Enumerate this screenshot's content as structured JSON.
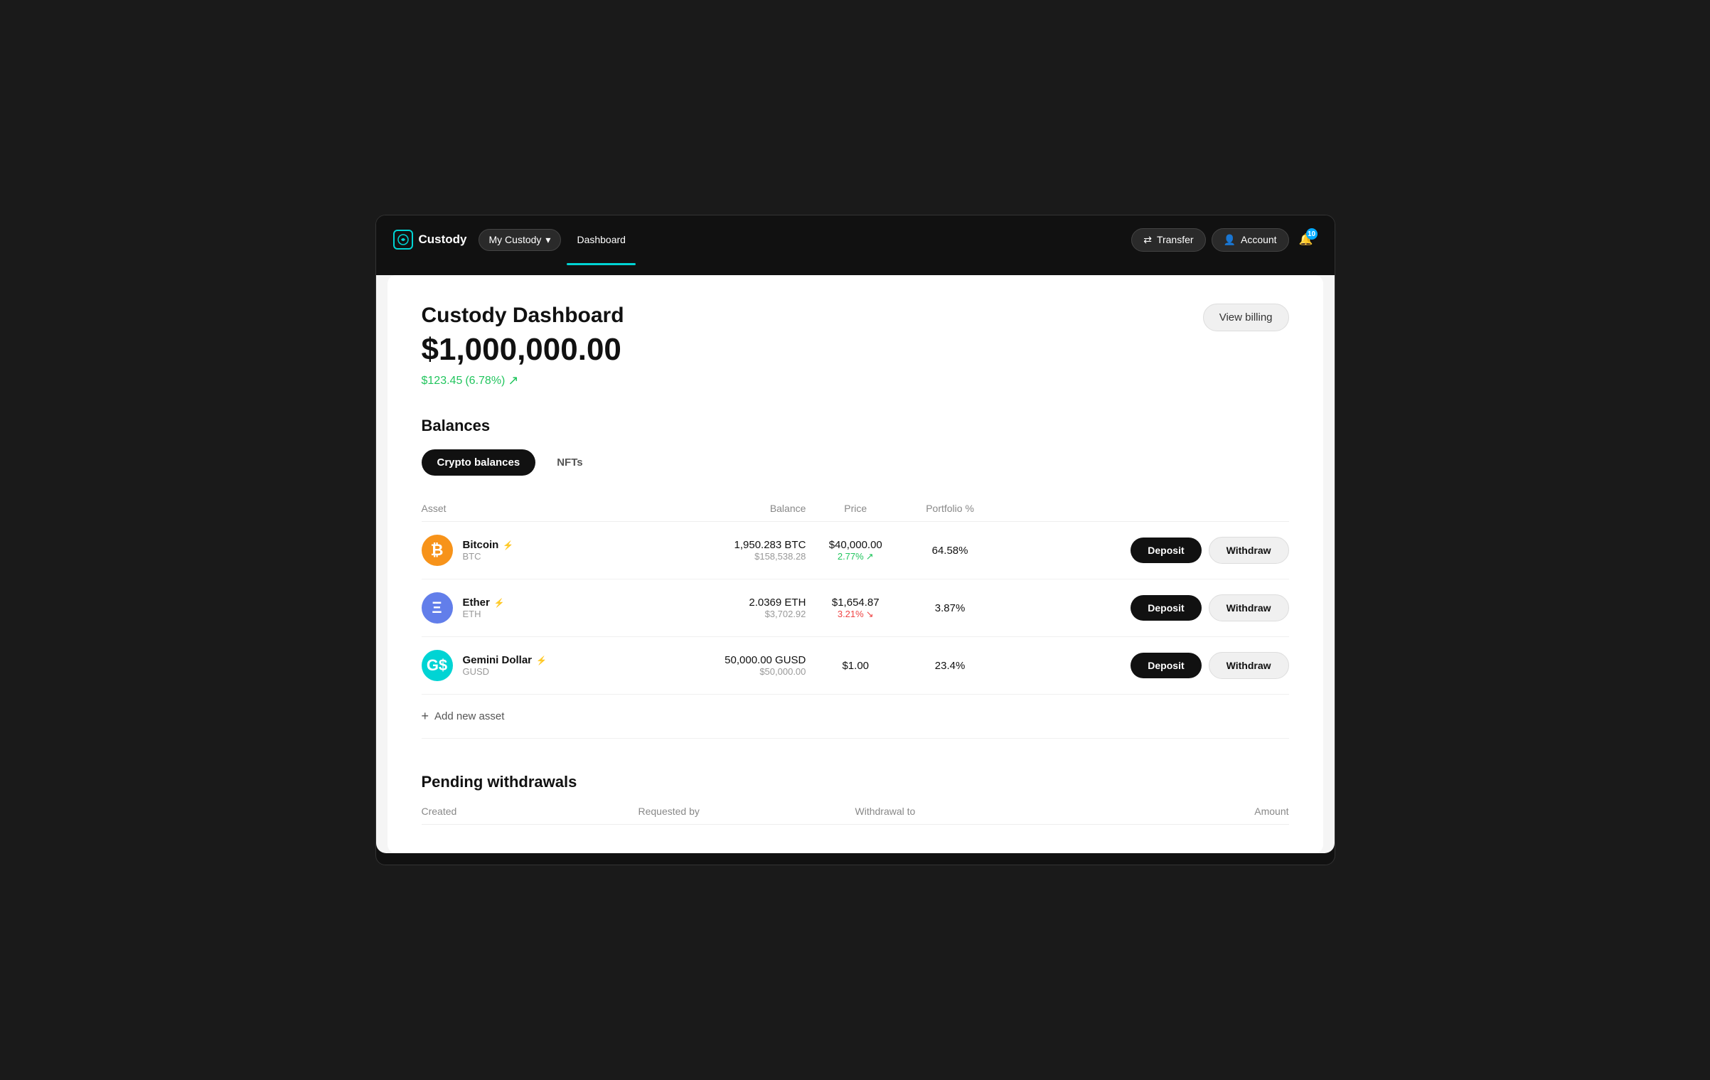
{
  "app": {
    "brand_label": "Custody",
    "nav_mycustody": "My Custody",
    "nav_dashboard": "Dashboard"
  },
  "header_actions": {
    "transfer_label": "Transfer",
    "account_label": "Account",
    "notif_count": "10"
  },
  "dashboard": {
    "title": "Custody Dashboard",
    "total_value": "$1,000,000.00",
    "change_amount": "$123.45",
    "change_percent": "(6.78%)",
    "view_billing": "View billing"
  },
  "balances": {
    "section_title": "Balances",
    "tab_crypto": "Crypto balances",
    "tab_nfts": "NFTs",
    "table_headers": {
      "asset": "Asset",
      "balance": "Balance",
      "price": "Price",
      "portfolio": "Portfolio %"
    },
    "assets": [
      {
        "id": "btc",
        "name": "Bitcoin",
        "symbol": "BTC",
        "icon_label": "₿",
        "icon_class": "coin-btc",
        "balance_amount": "1,950.283 BTC",
        "balance_usd": "$158,538.28",
        "price": "$40,000.00",
        "change": "2.77%",
        "change_up": true,
        "portfolio": "64.58%",
        "deposit_label": "Deposit",
        "withdraw_label": "Withdraw"
      },
      {
        "id": "eth",
        "name": "Ether",
        "symbol": "ETH",
        "icon_label": "Ξ",
        "icon_class": "coin-eth",
        "balance_amount": "2.0369 ETH",
        "balance_usd": "$3,702.92",
        "price": "$1,654.87",
        "change": "3.21%",
        "change_up": false,
        "portfolio": "3.87%",
        "deposit_label": "Deposit",
        "withdraw_label": "Withdraw"
      },
      {
        "id": "gusd",
        "name": "Gemini Dollar",
        "symbol": "GUSD",
        "icon_label": "G$",
        "icon_class": "coin-gusd",
        "balance_amount": "50,000.00 GUSD",
        "balance_usd": "$50,000.00",
        "price": "$1.00",
        "change": null,
        "change_up": null,
        "portfolio": "23.4%",
        "deposit_label": "Deposit",
        "withdraw_label": "Withdraw"
      }
    ],
    "add_asset_label": "Add new asset"
  },
  "pending_withdrawals": {
    "section_title": "Pending withdrawals",
    "cols": {
      "created": "Created",
      "requested_by": "Requested by",
      "withdrawal_to": "Withdrawal to",
      "amount": "Amount"
    }
  }
}
